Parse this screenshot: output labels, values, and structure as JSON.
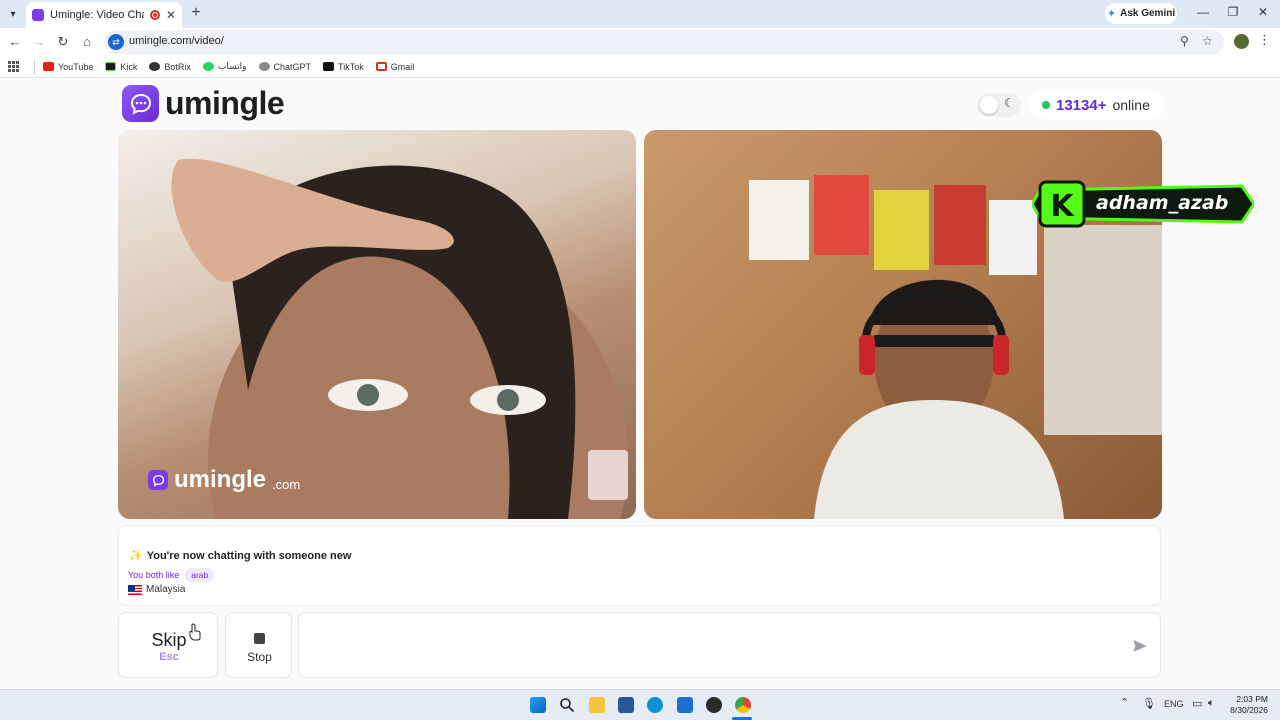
{
  "browser": {
    "tab_title": "Umingle: Video Chat with S",
    "new_tab": "+",
    "ask_gemini": "Ask Gemini",
    "url": "umingle.com/video/",
    "bookmarks": [
      {
        "label": "YouTube",
        "icon": "youtube-icon",
        "color": "#e62117"
      },
      {
        "label": "Kick",
        "icon": "kick-icon",
        "color": "#1a1a1a"
      },
      {
        "label": "BotRix",
        "icon": "botrix-icon",
        "color": "#333333"
      },
      {
        "label": "واتساب",
        "icon": "whatsapp-icon",
        "color": "#25d366"
      },
      {
        "label": "ChatGPT",
        "icon": "chatgpt-icon",
        "color": "#666666"
      },
      {
        "label": "TikTok",
        "icon": "tiktok-icon",
        "color": "#111111"
      },
      {
        "label": "Gmail",
        "icon": "gmail-icon",
        "color": "#d93025"
      }
    ]
  },
  "page": {
    "logo_text": "umingle",
    "online_count": "13134+",
    "online_label": "online",
    "watermark_text": "umingle",
    "watermark_suffix": ".com",
    "overlay_name": "adham_azab",
    "info": {
      "message": "You're now chatting with someone new",
      "both_like": "You both like",
      "interest_tag": "arab",
      "country": "Malaysia"
    },
    "skip_label": "Skip",
    "skip_key": "Esc",
    "stop_label": "Stop",
    "accent_color": "#6d28d9",
    "online_color": "#22c55e"
  },
  "taskbar": {
    "lang": "ENG",
    "time": "2:03 PM",
    "date": "8/30/2026"
  }
}
